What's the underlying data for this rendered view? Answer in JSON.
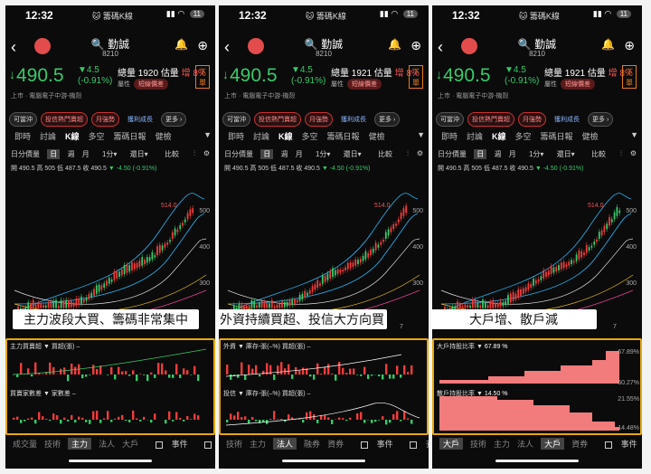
{
  "status": {
    "time": "12:32",
    "app_name": "籌碼K線",
    "battery": "11"
  },
  "stock": {
    "name": "勤誠",
    "code": "8210",
    "price": "490.5",
    "change": "▼4.5",
    "change_pct": "(-0.91%)",
    "order_button": "下單",
    "industry": "上市 · 電腦電子中游-機殼"
  },
  "volume_screens": [
    {
      "vol_label": "總量",
      "vol": "1920",
      "est_label": "估量",
      "est": "增 8%"
    },
    {
      "vol_label": "總量",
      "vol": "1921",
      "est_label": "估量",
      "est": "增 8%"
    },
    {
      "vol_label": "總量",
      "vol": "1921",
      "est_label": "估量",
      "est": "增 8%"
    }
  ],
  "attr": {
    "label": "屬性",
    "tag": "短線價差"
  },
  "chips": [
    "可當沖",
    "投信熱門賣超",
    "月強勢",
    "獲利成長",
    "更多 ›"
  ],
  "tabs": [
    [
      "即時",
      "討論",
      "K線",
      "多空",
      "籌碼日報",
      "健檢"
    ],
    [
      "即時",
      "討論",
      "K線",
      "多空",
      "籌碼日報",
      "健檢"
    ],
    [
      "即時",
      "討論",
      "K線",
      "多空",
      "籌碼日報",
      "健檢"
    ]
  ],
  "controls": {
    "daily_value": "日分價量",
    "day": "日",
    "week": "週",
    "month": "月",
    "minute": "1分",
    "restore": "還日",
    "compare": "比較"
  },
  "ohlc": {
    "open": "開 490.5",
    "high": "高 505",
    "low": "低 487.5",
    "close": "收 490.5",
    "chg": "▼ -4.50 (-0.91%)"
  },
  "chart_data": {
    "type": "line",
    "y_ticks": [
      "500",
      "400",
      "300"
    ],
    "x_ticks": [
      "5",
      "6",
      "7"
    ],
    "high_marker": "514.0"
  },
  "captions": [
    "主力波段大買、籌碼非常集中",
    "外資持續買超、投信大方向買",
    "大戶增、散戶減"
  ],
  "panels": [
    {
      "top_label": "主力買賣超",
      "top_unit": "買超(張) –",
      "bottom_label": "買賣家數差",
      "bottom_unit": "家數差 –"
    },
    {
      "top_label": "外資",
      "top_unit": "庫存-張(–%)  買超(張) –",
      "bottom_label": "投信",
      "bottom_unit": "庫存-張(–%)  買超(張) –"
    },
    {
      "top_label": "大戶持股比率",
      "top_value": "67.89 %",
      "bottom_label": "散戶持股比率",
      "bottom_value": "14.50 %",
      "ticks": [
        "67.89%",
        "60.27%",
        "21.55%",
        "14.48%"
      ]
    }
  ],
  "bottom_tabs": [
    [
      "成交量",
      "技術",
      "主力",
      "法人",
      "大戶"
    ],
    [
      "技術",
      "主力",
      "法人",
      "融券",
      "資券"
    ],
    [
      "大戶",
      "技術",
      "主力",
      "法人",
      "大戶",
      "資券"
    ]
  ],
  "bottom_active": [
    "主力",
    "法人",
    "大戶"
  ],
  "checkboxes": [
    "事件",
    "查價線"
  ],
  "colors": {
    "up": "#f03c3c",
    "down": "#39c96a",
    "accent": "#e8a80c",
    "blue": "#8ab6ff"
  }
}
